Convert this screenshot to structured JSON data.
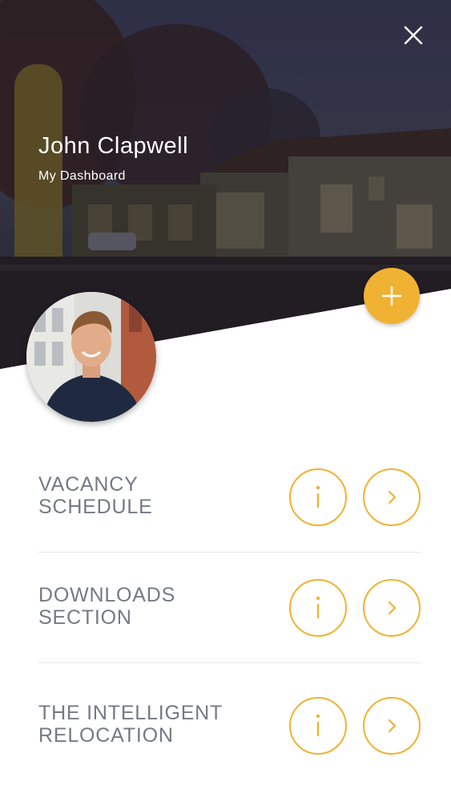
{
  "header": {
    "name": "John Clapwell",
    "subtitle": "My Dashboard",
    "close_icon": "close-icon",
    "add_icon": "plus-icon"
  },
  "colors": {
    "accent": "#f0b232",
    "label": "#747a85",
    "divider": "#e6e6e6"
  },
  "menu": [
    {
      "line1": "VACANCY",
      "line2": "SCHEDULE",
      "info_icon": "info-icon",
      "arrow_icon": "chevron-right-icon"
    },
    {
      "line1": "DOWNLOADS",
      "line2": "SECTION",
      "info_icon": "info-icon",
      "arrow_icon": "chevron-right-icon"
    },
    {
      "line1": "THE INTELLIGENT",
      "line2": "RELOCATION",
      "info_icon": "info-icon",
      "arrow_icon": "chevron-right-icon"
    }
  ]
}
